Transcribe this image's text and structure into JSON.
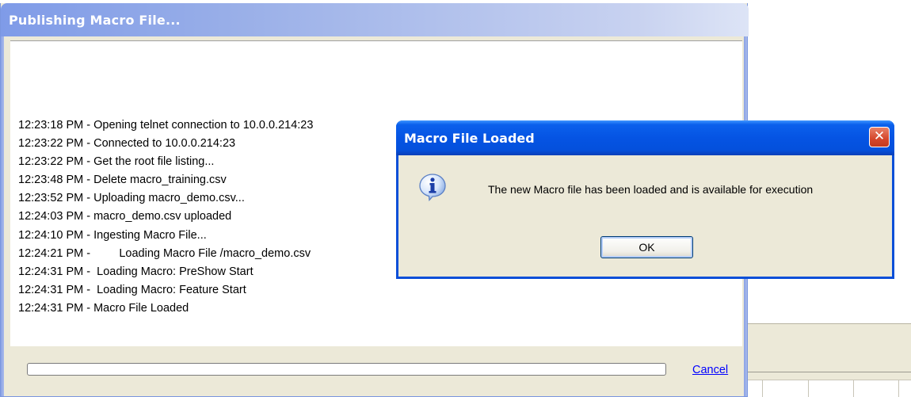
{
  "main_window": {
    "title": "Publishing Macro File...",
    "log": [
      "12:23:18 PM - Opening telnet connection to 10.0.0.214:23",
      "12:23:22 PM - Connected to 10.0.0.214:23",
      "12:23:22 PM - Get the root file listing...",
      "12:23:48 PM - Delete macro_training.csv",
      "12:23:52 PM - Uploading macro_demo.csv...",
      "12:24:03 PM - macro_demo.csv uploaded",
      "12:24:10 PM - Ingesting Macro File...",
      "12:24:21 PM -         Loading Macro File /macro_demo.csv",
      "12:24:31 PM -  Loading Macro: PreShow Start",
      "12:24:31 PM -  Loading Macro: Feature Start",
      "12:24:31 PM - Macro File Loaded"
    ],
    "progress": 0,
    "cancel_label": "Cancel"
  },
  "dialog": {
    "title": "Macro File Loaded",
    "close_glyph": "✕",
    "message": "The new Macro file has been loaded and is available for execution",
    "ok_label": "OK",
    "icon": "info-icon"
  },
  "colors": {
    "main_title_gradient_start": "#7f9be8",
    "dialog_title": "#0554e3",
    "close_button": "#d5462b",
    "link": "#0000ff",
    "window_face": "#ece9d8"
  }
}
